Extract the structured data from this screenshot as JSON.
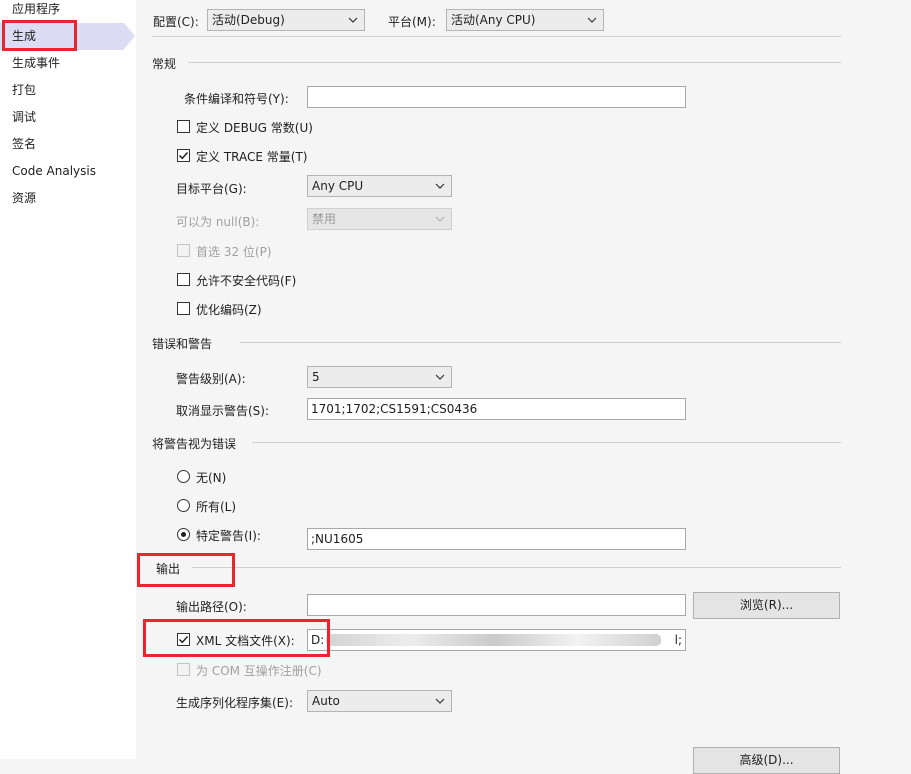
{
  "sidebar": {
    "items": [
      {
        "label": "应用程序"
      },
      {
        "label": "生成"
      },
      {
        "label": "生成事件"
      },
      {
        "label": "打包"
      },
      {
        "label": "调试"
      },
      {
        "label": "签名"
      },
      {
        "label": "Code Analysis"
      },
      {
        "label": "资源"
      }
    ],
    "selected": "生成"
  },
  "header": {
    "config_label": "配置(C):",
    "config_value": "活动(Debug)",
    "platform_label": "平台(M):",
    "platform_value": "活动(Any CPU)"
  },
  "general": {
    "title": "常规",
    "conditional_symbols_label": "条件编译和符号(Y):",
    "conditional_symbols_value": "",
    "define_debug_label": "定义 DEBUG 常数(U)",
    "define_debug_checked": false,
    "define_trace_label": "定义 TRACE 常量(T)",
    "define_trace_checked": true,
    "platform_target_label": "目标平台(G):",
    "platform_target_value": "Any CPU",
    "nullable_label": "可以为 null(B):",
    "nullable_value": "禁用",
    "prefer32_label": "首选 32 位(P)",
    "unsafe_label": "允许不安全代码(F)",
    "optimize_label": "优化编码(Z)"
  },
  "errors": {
    "title": "错误和警告",
    "warning_level_label": "警告级别(A):",
    "warning_level_value": "5",
    "suppress_label": "取消显示警告(S):",
    "suppress_value": "1701;1702;CS1591;CS0436"
  },
  "treat_warnings": {
    "title": "将警告视为错误",
    "none_label": "无(N)",
    "all_label": "所有(L)",
    "specific_label": "特定警告(I):",
    "specific_value": ";NU1605",
    "selected": "specific"
  },
  "output": {
    "title": "输出",
    "output_path_label": "输出路径(O):",
    "output_path_value": "",
    "browse_label": "浏览(R)...",
    "xml_doc_label": "XML 文档文件(X):",
    "xml_doc_checked": true,
    "xml_doc_value_start": "D:",
    "xml_doc_value_end": "l;",
    "com_interop_label": "为 COM 互操作注册(C)",
    "serialization_label": "生成序列化程序集(E):",
    "serialization_value": "Auto",
    "advanced_label": "高级(D)..."
  },
  "colors": {
    "highlight_red": "#e8262f",
    "selected_nav": "#dcdcf4",
    "page_bg": "#f5f5f5"
  }
}
